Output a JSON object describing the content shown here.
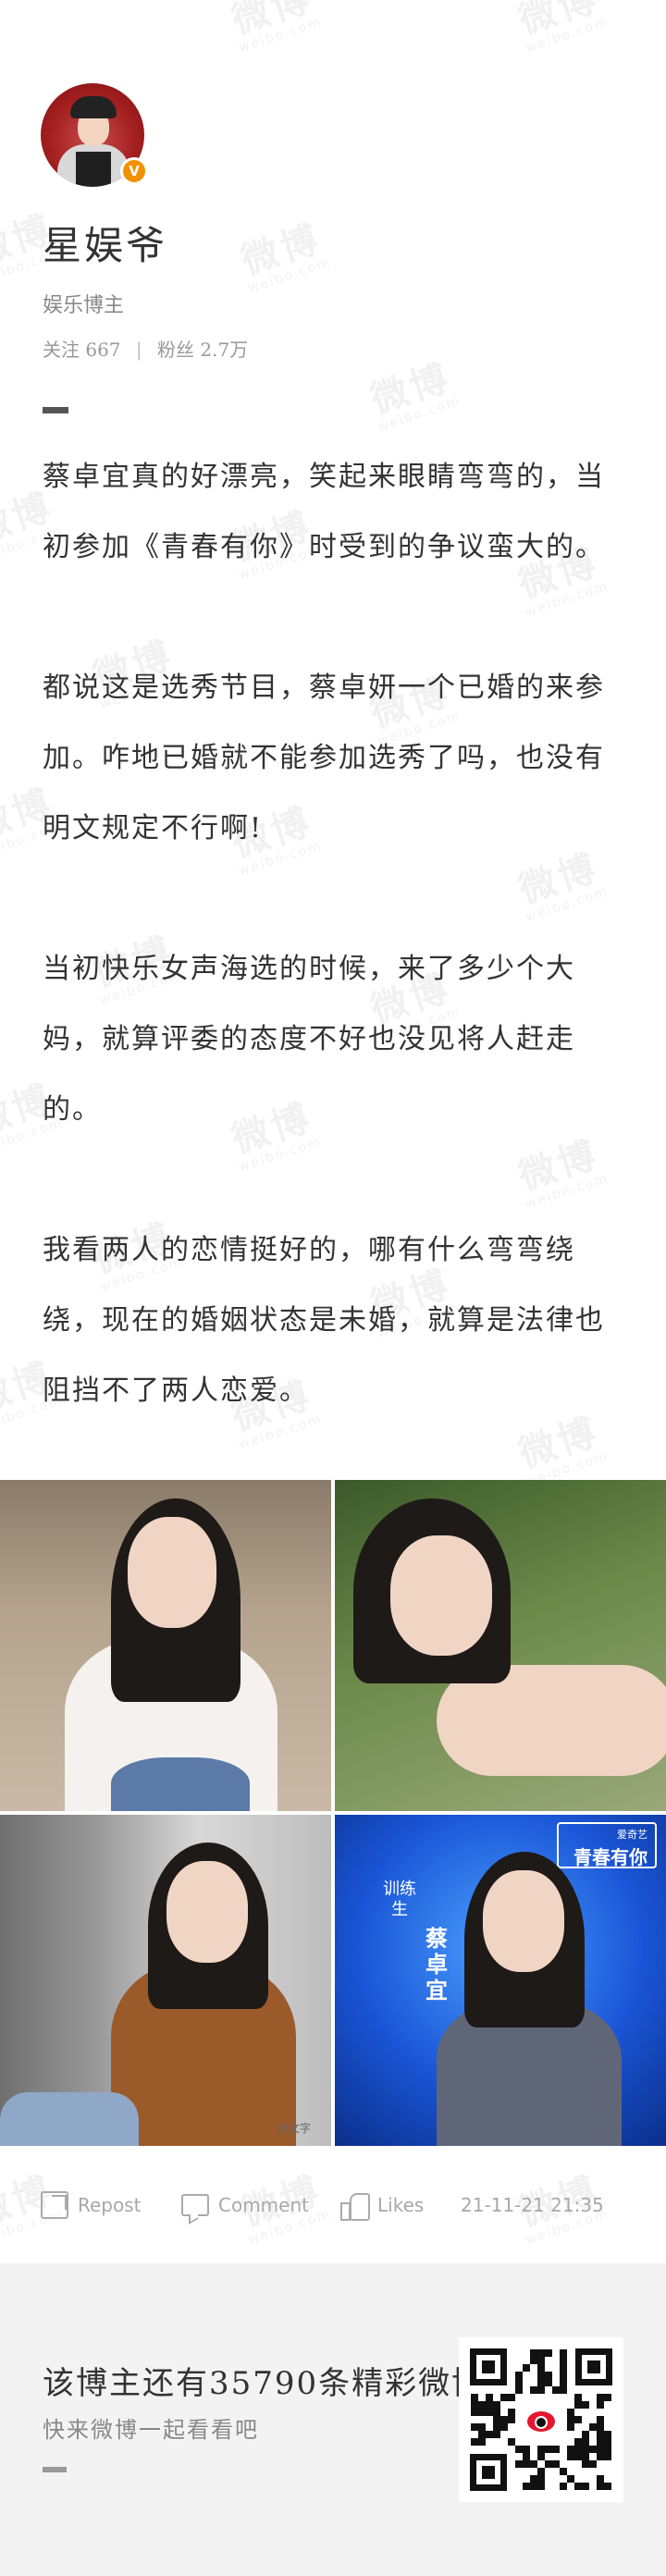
{
  "watermark": {
    "main": "微博",
    "sub": "weibo.com"
  },
  "account": {
    "name": "星娱爷",
    "description": "娱乐博主",
    "following_label": "关注",
    "following_count": "667",
    "followers_label": "粉丝",
    "followers_count": "2.7万",
    "verified_badge": "V",
    "avatar_icon": "user-avatar",
    "badge_color": "#f29100"
  },
  "article": {
    "paragraphs": [
      "蔡卓宜真的好漂亮，笑起来眼睛弯弯的，当初参加《青春有你》时受到的争议蛮大的。",
      "都说这是选秀节目，蔡卓妍一个已婚的来参加。咋地已婚就不能参加选秀了吗，也没有明文规定不行啊!",
      "当初快乐女声海选的时候，来了多少个大妈，就算评委的态度不好也没见将人赶走的。",
      "我看两人的恋情挺好的，哪有什么弯弯绕绕，现在的婚姻状态是未婚，就算是法律也阻挡不了两人恋爱。"
    ]
  },
  "photos": {
    "logo_small": "爱奇艺",
    "logo_main": "青春有你",
    "tag_vertical": "训练生",
    "name_vertical": "蔡卓宜",
    "credit": "@文字"
  },
  "actions": {
    "repost": "Repost",
    "comment": "Comment",
    "like": "Likes",
    "time": "21-11-21 21:35"
  },
  "footer": {
    "line1": "该博主还有35790条精彩微博",
    "line2": "快来微博一起看看吧",
    "qr_icon": "qr-code",
    "brand_color": "#e6162d"
  }
}
